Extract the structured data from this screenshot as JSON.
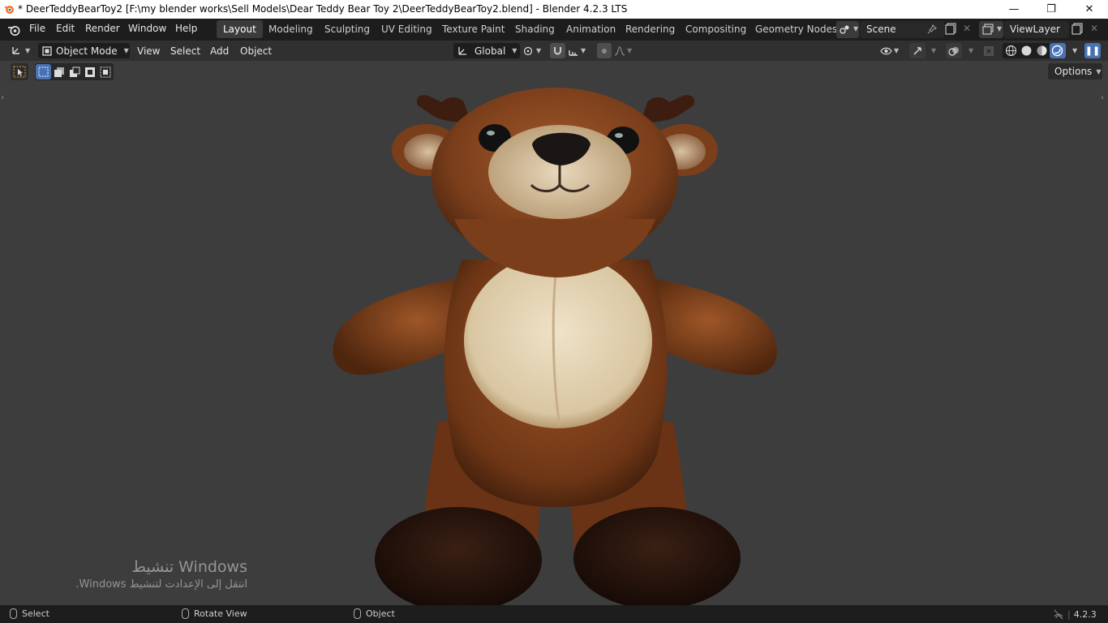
{
  "window": {
    "title": "* DeerTeddyBearToy2 [F:\\my blender works\\Sell Models\\Dear Teddy Bear Toy 2\\DeerTeddyBearToy2.blend] - Blender 4.2.3 LTS",
    "minimize": "—",
    "maximize": "❐",
    "close": "✕"
  },
  "menu": [
    "File",
    "Edit",
    "Render",
    "Window",
    "Help"
  ],
  "workspaces": [
    "Layout",
    "Modeling",
    "Sculpting",
    "UV Editing",
    "Texture Paint",
    "Shading",
    "Animation",
    "Rendering",
    "Compositing",
    "Geometry Nodes"
  ],
  "active_workspace": "Layout",
  "scene": {
    "label": "Scene"
  },
  "view_layer": {
    "label": "ViewLayer"
  },
  "header": {
    "mode": "Object Mode",
    "menus": [
      "View",
      "Select",
      "Add",
      "Object"
    ],
    "transform_orientation": "Global",
    "options": "Options"
  },
  "watermark": {
    "line1": "Windows تنشيط",
    "line2": "انتقل إلى الإعدادت لتنشيط Windows."
  },
  "status": {
    "select": "Select",
    "rotate": "Rotate View",
    "object": "Object",
    "version": "4.2.3"
  },
  "colors": {
    "accent": "#4772b3",
    "topbar": "#1d1d1d",
    "header": "#303030",
    "viewport": "#3d3d3d"
  }
}
